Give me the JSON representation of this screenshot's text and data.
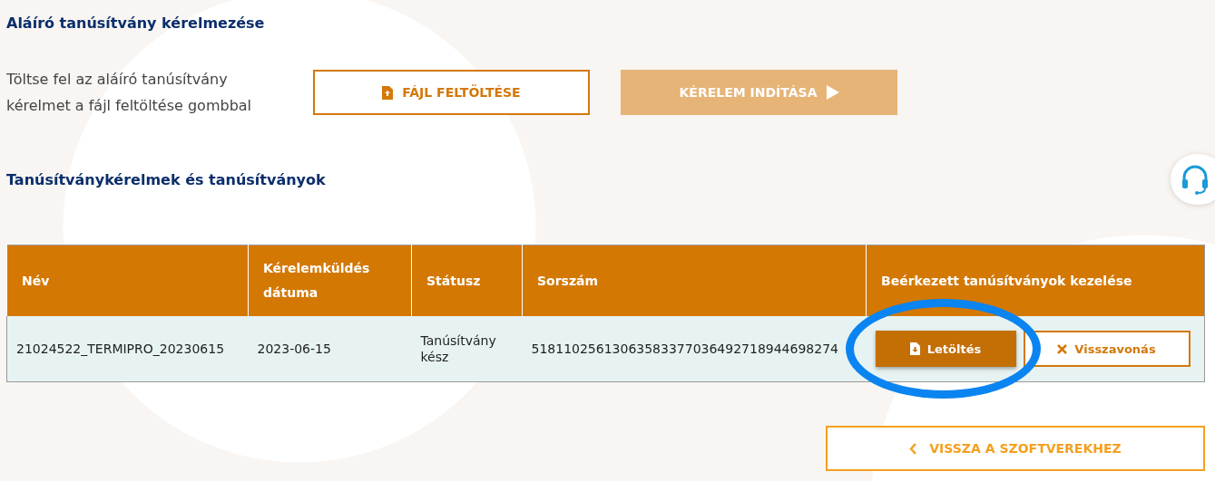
{
  "request_section": {
    "title": "Aláíró tanúsítvány kérelmezése",
    "description": "Töltse fel az aláíró tanúsítvány kérelmet a fájl feltöltése gombbal",
    "buttons": [
      {
        "kind": "upload",
        "label": "FÁJL FELTÖLTÉSE",
        "disabled": false
      },
      {
        "kind": "start",
        "label": "KÉRELEM INDÍTÁSA",
        "disabled": true
      }
    ]
  },
  "list_section": {
    "title": "Tanúsítványkérelmek és tanúsítványok"
  },
  "table": {
    "columns": [
      "Név",
      "Kérelemküldés dátuma",
      "Státusz",
      "Sorszám",
      "Beérkezett tanúsítványok kezelése"
    ],
    "rows": [
      {
        "name": "21024522_TERMIPRO_20230615",
        "date": "2023-06-15",
        "status": "Tanúsítvány kész",
        "serial": "51811025613063583377036492718944698274",
        "actions": [
          {
            "kind": "download",
            "label": "Letöltés"
          },
          {
            "kind": "revoke",
            "label": "Visszavonás"
          }
        ]
      }
    ]
  },
  "back_button": {
    "label": "VISSZA A SZOFTVEREKHEZ"
  }
}
